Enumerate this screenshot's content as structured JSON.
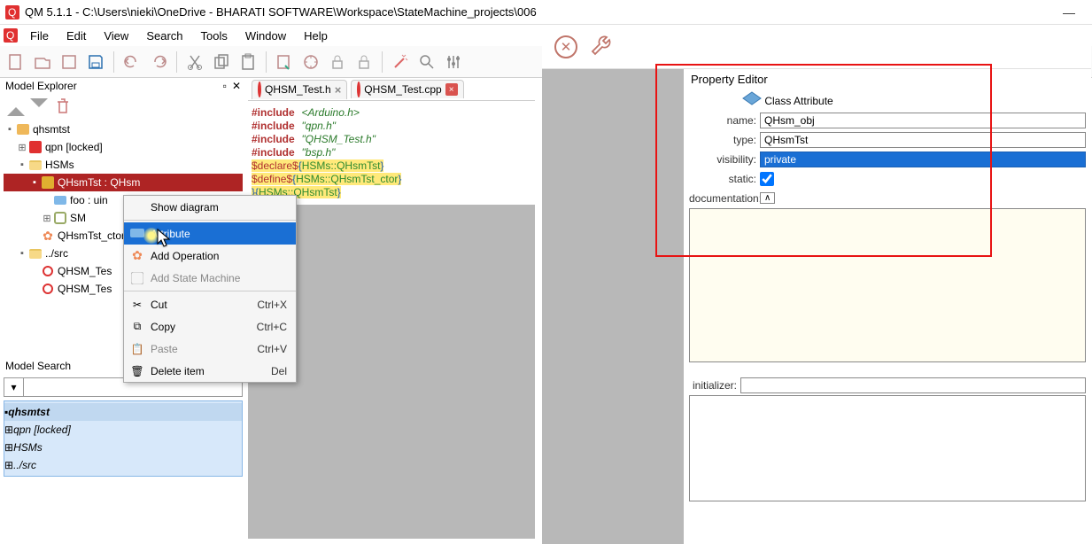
{
  "window": {
    "title": "QM 5.1.1 - C:\\Users\\nieki\\OneDrive - BHARATI SOFTWARE\\Workspace\\StateMachine_projects\\006",
    "minimize": "—"
  },
  "menu": {
    "file": "File",
    "edit": "Edit",
    "view": "View",
    "search": "Search",
    "tools": "Tools",
    "window": "Window",
    "help": "Help"
  },
  "explorer": {
    "title": "Model Explorer",
    "root": "qhsmtst",
    "qpn": "qpn [locked]",
    "hsms": "HSMs",
    "qhsm_class": "QHsmTst : QHsm",
    "foo": "foo : uin",
    "sm": "SM",
    "ctor": "QHsmTst_ctor",
    "src": "../src",
    "testh": "QHSM_Tes",
    "testcpp": "QHSM_Tes"
  },
  "contextmenu": {
    "show": "Show diagram",
    "attr": "Attribute",
    "oper": "Add Operation",
    "asm": "Add State Machine",
    "cut": "Cut",
    "cut_s": "Ctrl+X",
    "copy": "Copy",
    "copy_s": "Ctrl+C",
    "paste": "Paste",
    "paste_s": "Ctrl+V",
    "del": "Delete item",
    "del_s": "Del"
  },
  "tabs": {
    "h": "QHSM_Test.h",
    "cpp": "QHSM_Test.cpp"
  },
  "code": {
    "l1_kw": "#include",
    "l1_str": "<Arduino.h>",
    "l2_kw": "#include",
    "l2_str": "\"qpn.h\"",
    "l3_kw": "#include",
    "l3_str": "\"QHSM_Test.h\"",
    "l4_kw": "#include",
    "l4_str": "\"bsp.h\"",
    "l5": "$declare${HSMs::QHsmTst}",
    "l6": "$define${HSMs::QHsmTst_ctor}",
    "l7": "${HSMs::QHsmTst}"
  },
  "search": {
    "title": "Model Search",
    "root": "qhsmtst",
    "qpn": "qpn [locked]",
    "hsms": "HSMs",
    "src": "../src"
  },
  "prop": {
    "title": "Property Editor",
    "classlabel": "Class Attribute",
    "name_l": "name:",
    "name_v": "QHsm_obj",
    "type_l": "type:",
    "type_v": "QHsmTst",
    "vis_l": "visibility:",
    "vis_v": "private",
    "static_l": "static:",
    "doc_l": "documentation:",
    "init_l": "initializer:"
  }
}
